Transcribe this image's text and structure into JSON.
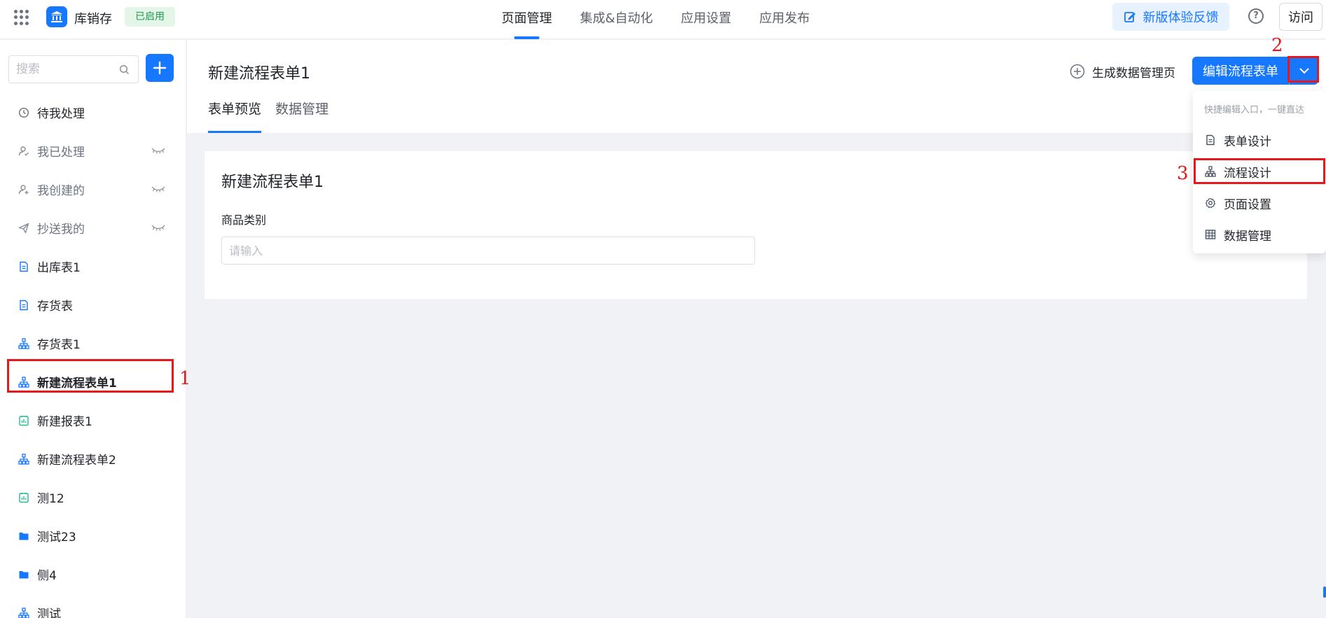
{
  "topbar": {
    "app_name": "库销存",
    "status_badge": "已启用",
    "nav": [
      "页面管理",
      "集成&自动化",
      "应用设置",
      "应用发布"
    ],
    "feedback_label": "新版体验反馈",
    "visit_label": "访问"
  },
  "sidebar": {
    "search_placeholder": "搜索",
    "items": [
      {
        "label": "待我处理",
        "icon": "clock-icon"
      },
      {
        "label": "我已处理",
        "icon": "user-check-icon"
      },
      {
        "label": "我创建的",
        "icon": "user-add-icon"
      },
      {
        "label": "抄送我的",
        "icon": "send-icon"
      },
      {
        "label": "出库表1",
        "icon": "form-doc-icon"
      },
      {
        "label": "存货表",
        "icon": "form-doc-icon"
      },
      {
        "label": "存货表1",
        "icon": "flow-icon"
      },
      {
        "label": "新建流程表单1",
        "icon": "flow-icon"
      },
      {
        "label": "新建报表1",
        "icon": "report-icon"
      },
      {
        "label": "新建流程表单2",
        "icon": "flow-icon"
      },
      {
        "label": "测12",
        "icon": "report-icon"
      },
      {
        "label": "测试23",
        "icon": "folder-icon"
      },
      {
        "label": "侧4",
        "icon": "folder-icon"
      },
      {
        "label": "测试",
        "icon": "flow-icon"
      }
    ]
  },
  "main": {
    "title": "新建流程表单1",
    "generate_label": "生成数据管理页",
    "edit_label": "编辑流程表单",
    "tabs": [
      "表单预览",
      "数据管理"
    ],
    "form": {
      "title": "新建流程表单1",
      "field_label": "商品类别",
      "field_placeholder": "请输入"
    }
  },
  "dropdown": {
    "hint": "快捷编辑入口，一键直达",
    "items": [
      "表单设计",
      "流程设计",
      "页面设置",
      "数据管理"
    ]
  },
  "annotations": [
    "1",
    "2",
    "3"
  ],
  "colors": {
    "accent": "#1677ff",
    "annotation": "#e5191c",
    "badge_bg": "#e3f6e8",
    "badge_text": "#1f9b4d"
  }
}
